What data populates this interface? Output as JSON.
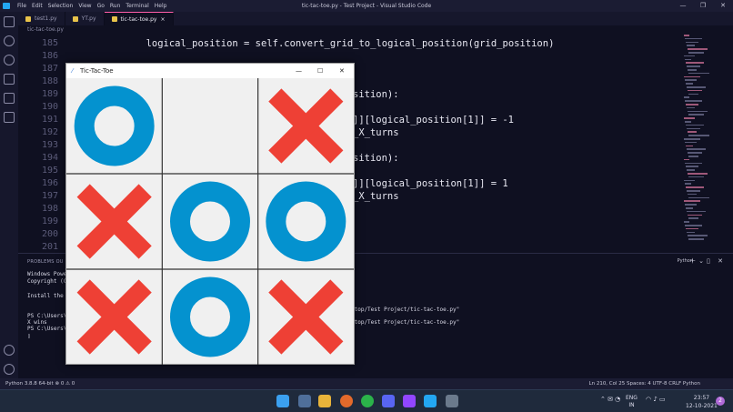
{
  "titlebar": {
    "menu": [
      "File",
      "Edit",
      "Selection",
      "View",
      "Go",
      "Run",
      "Terminal",
      "Help"
    ],
    "title": "tic-tac-toe.py - Test Project - Visual Studio Code"
  },
  "tabs": [
    {
      "label": "test1.py"
    },
    {
      "label": "YT.py"
    },
    {
      "label": "tic-tac-toe.py",
      "close": "×"
    }
  ],
  "breadcrumb": "tic-tac-toe.py",
  "editor": {
    "lines": [
      {
        "no": "185",
        "code": "        logical_position = self.convert_grid_to_logical_position(grid_position)"
      },
      {
        "no": "186",
        "code": ""
      },
      {
        "no": "187",
        "code": ""
      },
      {
        "no": "188",
        "code": ""
      },
      {
        "no": "189",
        "code": "sition):"
      },
      {
        "no": "190",
        "code": ""
      },
      {
        "no": "191",
        "code": "]][logical_position[1]] = -1"
      },
      {
        "no": "192",
        "code": "_X_turns"
      },
      {
        "no": "193",
        "code": ""
      },
      {
        "no": "194",
        "code": "sition):"
      },
      {
        "no": "195",
        "code": ""
      },
      {
        "no": "196",
        "code": "]][logical_position[1]] = 1"
      },
      {
        "no": "197",
        "code": "_X_turns"
      },
      {
        "no": "198",
        "code": ""
      },
      {
        "no": "199",
        "code": ""
      },
      {
        "no": "200",
        "code": ""
      },
      {
        "no": "201",
        "code": ""
      }
    ]
  },
  "panel": {
    "tabs": "PROBLEMS   OU",
    "terminal": [
      "Windows Powe",
      "Copyright (C)",
      "",
      "Install the l",
      "",
      "PS C:\\Users\\",
      "X wins",
      "PS C:\\Users\\",
      "▯"
    ],
    "terminal_right": [
      "ktop/Test Project/tic-tac-toe.py\"",
      "ktop/Test Project/tic-tac-toe.py\""
    ],
    "shell": "Python"
  },
  "status": {
    "left": "Python 3.8.8 64-bit   ⊗ 0 ⚠ 0",
    "right": "Ln 210, Col 25   Spaces: 4   UTF-8   CRLF   Python"
  },
  "taskbar": {
    "lang": "ENG",
    "region": "IN",
    "time": "23:57",
    "date": "12-10-2021",
    "badge": "2"
  },
  "ttt": {
    "title": "Tic-Tac-Toe",
    "board": [
      [
        "O",
        "",
        "X"
      ],
      [
        "X",
        "O",
        "O"
      ],
      [
        "X",
        "O",
        "X"
      ]
    ],
    "o_color": "#0492cf",
    "x_color": "#ee4035"
  }
}
